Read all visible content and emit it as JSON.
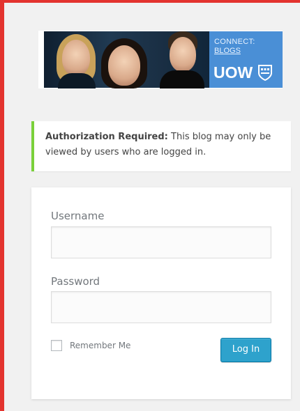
{
  "header": {
    "connect_text": "CONNECT:",
    "blogs_text": "BLOGS",
    "uow_text": "UOW",
    "logo_icon": "uow-crest-icon"
  },
  "notice": {
    "bold_label": "Authorization Required:",
    "text": " This blog may only be viewed by users who are logged in.",
    "accent_color": "#7ad03a"
  },
  "login_form": {
    "username_label": "Username",
    "username_value": "",
    "password_label": "Password",
    "password_value": "",
    "remember_label": "Remember Me",
    "remember_checked": false,
    "submit_label": "Log In",
    "button_color": "#2ea2cc"
  },
  "frame": {
    "border_color": "#e3342f"
  }
}
